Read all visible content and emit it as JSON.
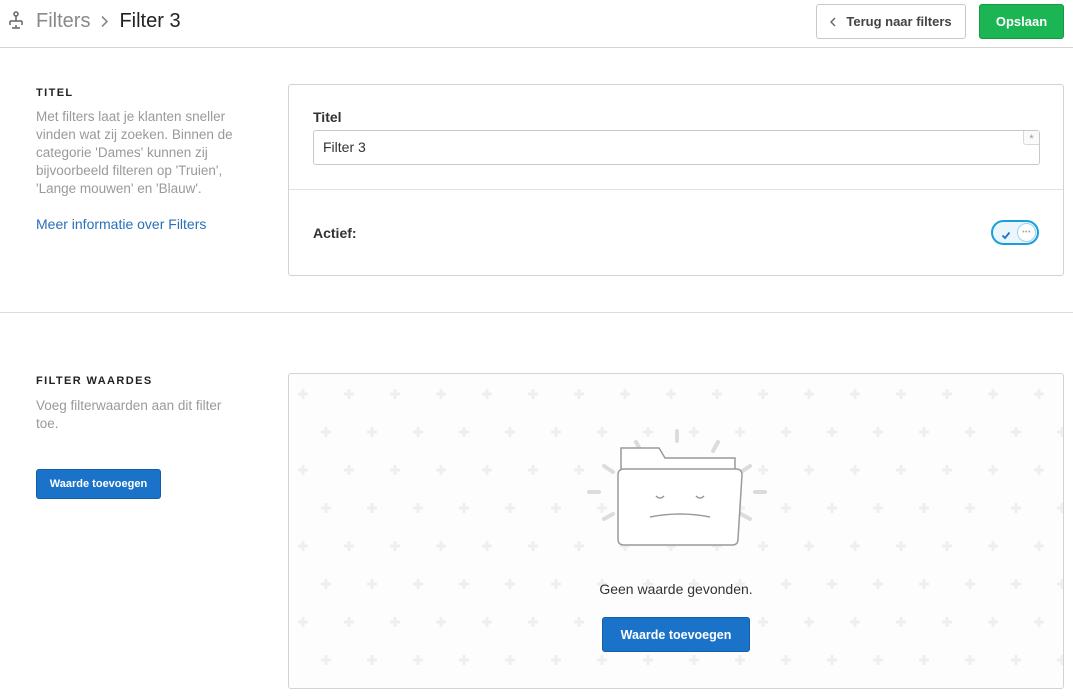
{
  "header": {
    "logo_icon": "filter-tree-icon",
    "breadcrumb_parent": "Filters",
    "breadcrumb_separator_icon": "chevron-right-icon",
    "breadcrumb_current": "Filter 3",
    "back_button_label": "Terug naar filters",
    "save_button_label": "Opslaan"
  },
  "colors": {
    "save_green": "#1bb553",
    "primary_blue": "#1a73c8",
    "link_blue": "#2a6fb7",
    "toggle_blue": "#1a9fd8"
  },
  "title_section": {
    "heading": "TITEL",
    "description": "Met filters laat je klanten sneller vinden wat zij zoeken. Binnen de categorie 'Dames' kunnen zij bijvoorbeeld filteren op 'Truien', 'Lange mouwen' en 'Blauw'.",
    "info_link": "Meer informatie over Filters",
    "field_label": "Titel",
    "field_value": "Filter 3",
    "required_mark": "*",
    "active_label": "Actief:",
    "active_on": true
  },
  "values_section": {
    "heading": "FILTER WAARDES",
    "description": "Voeg filterwaarden aan dit filter toe.",
    "add_button_label": "Waarde toevoegen",
    "empty_icon": "sad-folder-icon",
    "empty_text": "Geen waarde gevonden.",
    "empty_add_button_label": "Waarde toevoegen"
  }
}
